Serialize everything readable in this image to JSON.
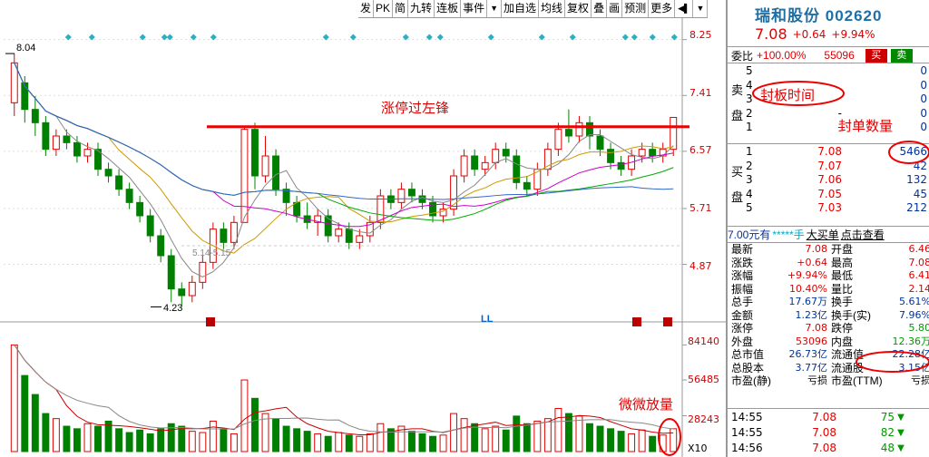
{
  "toolbar": {
    "buttons": [
      "发",
      "PK",
      "简",
      "九转",
      "连板",
      "事件",
      "加自选",
      "均线",
      "复权",
      "叠",
      "画",
      "预测",
      "更多"
    ]
  },
  "chart": {
    "price_axis": [
      "8.25",
      "7.41",
      "6.57",
      "5.71",
      "4.87"
    ],
    "volume_axis": [
      "84140",
      "56485",
      "28243"
    ],
    "volume_multiplier": "X10",
    "high_marker": "8.04",
    "low_marker": "4.23",
    "range_marker": "5.14-5.15",
    "annotation_limit_up": "涨停过左锋",
    "annotation_volume": "微微放量",
    "marker_ll": "LL"
  },
  "chart_data": {
    "type": "candlestick",
    "price_range": [
      4.23,
      8.25
    ],
    "candles": [
      [
        7.3,
        7.9,
        7.1,
        8.04
      ],
      [
        7.6,
        7.2,
        7.0,
        7.7
      ],
      [
        7.2,
        7.0,
        6.8,
        7.4
      ],
      [
        7.0,
        6.6,
        6.5,
        7.1
      ],
      [
        6.6,
        6.8,
        6.5,
        6.9
      ],
      [
        6.8,
        6.7,
        6.6,
        6.9
      ],
      [
        6.7,
        6.5,
        6.4,
        6.8
      ],
      [
        6.5,
        6.6,
        6.4,
        6.7
      ],
      [
        6.6,
        6.3,
        6.2,
        6.7
      ],
      [
        6.3,
        6.2,
        6.1,
        6.4
      ],
      [
        6.2,
        6.0,
        5.9,
        6.3
      ],
      [
        6.0,
        5.8,
        5.7,
        6.1
      ],
      [
        5.8,
        5.6,
        5.5,
        5.9
      ],
      [
        5.6,
        5.3,
        5.2,
        5.7
      ],
      [
        5.3,
        5.0,
        4.9,
        5.4
      ],
      [
        5.0,
        4.5,
        4.3,
        5.1
      ],
      [
        4.5,
        4.4,
        4.23,
        4.6
      ],
      [
        4.4,
        4.6,
        4.3,
        4.7
      ],
      [
        4.6,
        4.9,
        4.5,
        5.0
      ],
      [
        4.9,
        5.4,
        4.8,
        5.5
      ],
      [
        5.4,
        5.2,
        5.1,
        5.5
      ],
      [
        5.2,
        5.5,
        5.1,
        5.6
      ],
      [
        5.5,
        6.9,
        5.5,
        6.95
      ],
      [
        6.9,
        6.2,
        6.0,
        7.0
      ],
      [
        6.2,
        6.5,
        6.1,
        6.8
      ],
      [
        6.5,
        6.0,
        5.9,
        6.6
      ],
      [
        6.0,
        5.8,
        5.6,
        6.1
      ],
      [
        5.8,
        5.6,
        5.5,
        5.9
      ],
      [
        5.6,
        5.5,
        5.4,
        5.8
      ],
      [
        5.5,
        5.6,
        5.3,
        5.7
      ],
      [
        5.6,
        5.3,
        5.2,
        5.7
      ],
      [
        5.3,
        5.4,
        5.2,
        5.5
      ],
      [
        5.4,
        5.2,
        5.1,
        5.5
      ],
      [
        5.2,
        5.3,
        5.1,
        5.4
      ],
      [
        5.3,
        5.5,
        5.2,
        5.6
      ],
      [
        5.5,
        5.9,
        5.4,
        6.0
      ],
      [
        5.9,
        5.8,
        5.7,
        6.0
      ],
      [
        5.8,
        6.0,
        5.7,
        6.1
      ],
      [
        6.0,
        5.9,
        5.8,
        6.1
      ],
      [
        5.9,
        5.8,
        5.7,
        6.0
      ],
      [
        5.8,
        5.6,
        5.5,
        5.9
      ],
      [
        5.6,
        5.7,
        5.5,
        5.8
      ],
      [
        5.7,
        6.2,
        5.6,
        6.3
      ],
      [
        6.2,
        6.5,
        6.1,
        6.6
      ],
      [
        6.5,
        6.3,
        6.2,
        6.6
      ],
      [
        6.3,
        6.4,
        6.2,
        6.5
      ],
      [
        6.4,
        6.6,
        6.3,
        6.7
      ],
      [
        6.6,
        6.5,
        6.4,
        6.7
      ],
      [
        6.5,
        6.1,
        6.0,
        6.6
      ],
      [
        6.1,
        6.0,
        5.9,
        6.2
      ],
      [
        6.0,
        6.3,
        5.9,
        6.4
      ],
      [
        6.3,
        6.6,
        6.2,
        6.7
      ],
      [
        6.6,
        6.9,
        6.5,
        7.0
      ],
      [
        6.9,
        6.8,
        6.7,
        7.2
      ],
      [
        6.8,
        7.0,
        6.7,
        7.1
      ],
      [
        7.0,
        6.8,
        6.6,
        7.1
      ],
      [
        6.8,
        6.6,
        6.5,
        6.9
      ],
      [
        6.6,
        6.4,
        6.3,
        6.7
      ],
      [
        6.4,
        6.3,
        6.2,
        6.5
      ],
      [
        6.3,
        6.5,
        6.2,
        6.6
      ],
      [
        6.5,
        6.6,
        6.4,
        6.7
      ],
      [
        6.6,
        6.5,
        6.4,
        6.7
      ],
      [
        6.5,
        6.6,
        6.4,
        6.7
      ],
      [
        6.6,
        7.08,
        6.5,
        7.08
      ]
    ],
    "volumes": [
      84140,
      60000,
      45000,
      30000,
      26000,
      20000,
      18000,
      22000,
      20000,
      24000,
      18000,
      15000,
      17000,
      14000,
      18000,
      22000,
      20000,
      16000,
      15000,
      24000,
      18000,
      14000,
      56485,
      42000,
      30000,
      26000,
      20000,
      18000,
      16000,
      14000,
      12000,
      15000,
      13000,
      12000,
      14000,
      22000,
      18000,
      20000,
      16000,
      14000,
      12000,
      13000,
      30000,
      26000,
      22000,
      18000,
      20000,
      17000,
      28000,
      22000,
      24000,
      26000,
      34000,
      30000,
      28000,
      22000,
      20000,
      18000,
      16000,
      14000,
      17000,
      12000,
      13000,
      18000
    ]
  },
  "panel": {
    "name": "瑞和股份",
    "code": "002620",
    "price": "7.08",
    "change": "+0.64",
    "change_pct": "+9.94%",
    "weibi_label": "委比",
    "weibi": "+100.00%",
    "weicha": "55096",
    "buy_btn": "买",
    "sell_btn": "卖",
    "sell_side": "卖盘",
    "buy_side": "买盘",
    "sell_levels": [
      {
        "lv": "5",
        "price": "",
        "vol": "0"
      },
      {
        "lv": "4",
        "price": "",
        "vol": "0"
      },
      {
        "lv": "3",
        "price": "",
        "vol": "0"
      },
      {
        "lv": "2",
        "price": "-",
        "vol": "0"
      },
      {
        "lv": "1",
        "price": "-",
        "vol": "0"
      }
    ],
    "buy_levels": [
      {
        "lv": "1",
        "price": "7.08",
        "vol": "5466"
      },
      {
        "lv": "2",
        "price": "7.07",
        "vol": "42"
      },
      {
        "lv": "3",
        "price": "7.06",
        "vol": "132"
      },
      {
        "lv": "4",
        "price": "7.05",
        "vol": "45"
      },
      {
        "lv": "5",
        "price": "7.03",
        "vol": "212"
      }
    ],
    "mid_row": [
      "7.00元有",
      "*****手",
      "大买单",
      "点击查看"
    ],
    "annot_time": "封板时间",
    "annot_qty": "封单数量",
    "stats": [
      [
        "最新",
        "7.08",
        "开盘",
        "6.46"
      ],
      [
        "涨跌",
        "+0.64",
        "最高",
        "7.08"
      ],
      [
        "涨幅",
        "+9.94%",
        "最低",
        "6.41"
      ],
      [
        "振幅",
        "10.40%",
        "量比",
        "2.14"
      ],
      [
        "总手",
        "17.67万",
        "换手",
        "5.61%"
      ],
      [
        "金额",
        "1.23亿",
        "换手(实)",
        "7.96%"
      ],
      [
        "涨停",
        "7.08",
        "跌停",
        "5.80"
      ],
      [
        "外盘",
        "53096",
        "内盘",
        "12.36万"
      ],
      [
        "总市值",
        "26.73亿",
        "流通值",
        "22.28亿"
      ],
      [
        "总股本",
        "3.77亿",
        "流通股",
        "3.15亿"
      ],
      [
        "市盈(静)",
        "亏损",
        "市盈(TTM)",
        "亏损"
      ]
    ],
    "ticks": [
      {
        "t": "14:55",
        "p": "7.08",
        "v": "75",
        "dir": "down"
      },
      {
        "t": "14:55",
        "p": "7.08",
        "v": "82",
        "dir": "down"
      },
      {
        "t": "14:56",
        "p": "7.08",
        "v": "48",
        "dir": "down"
      }
    ]
  }
}
